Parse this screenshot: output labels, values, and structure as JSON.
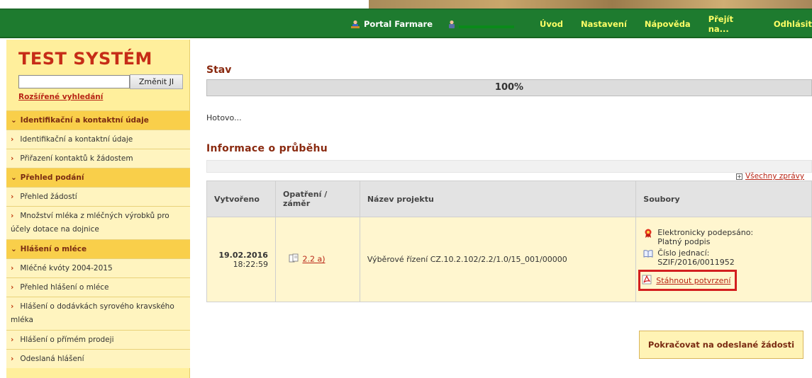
{
  "header": {
    "portal_label": "Portal Farmare",
    "nav": [
      "Úvod",
      "Nastavení",
      "Nápověda",
      "Přejít na...",
      "Odhlásit"
    ],
    "accent": "#1e7b2f"
  },
  "sidebar": {
    "logo": "TEST SYSTÉM",
    "search_value": "",
    "search_button": "Změnit JI",
    "advanced_search": "Rozšířené vyhledání",
    "menu": [
      {
        "type": "section",
        "label": "Identifikační a kontaktní údaje"
      },
      {
        "type": "item",
        "label": "Identifikační a kontaktní údaje"
      },
      {
        "type": "item",
        "label": "Přiřazení kontaktů k žádostem"
      },
      {
        "type": "section",
        "label": "Přehled podání"
      },
      {
        "type": "item",
        "label": "Přehled žádostí"
      },
      {
        "type": "item",
        "label": "Množství mléka z mléčných výrobků pro účely dotace na dojnice"
      },
      {
        "type": "section",
        "label": "Hlášení o mléce"
      },
      {
        "type": "item",
        "label": "Mléčné kvóty 2004-2015"
      },
      {
        "type": "item",
        "label": "Přehled hlášení o mléce"
      },
      {
        "type": "item",
        "label": "Hlášení o dodávkách syrového kravského mléka"
      },
      {
        "type": "item",
        "label": "Hlášení o přímém prodeji"
      },
      {
        "type": "item",
        "label": "Odeslaná hlášení"
      }
    ]
  },
  "main": {
    "stav_title": "Stav",
    "progress_text": "100%",
    "progress_value": 100,
    "status_text": "Hotovo...",
    "info_title": "Informace o průběhu",
    "all_messages": "Všechny zprávy",
    "table": {
      "headers": [
        "Vytvořeno",
        "Opatření / záměr",
        "Název projektu",
        "Soubory"
      ],
      "row": {
        "date": "19.02.2016",
        "time": "18:22:59",
        "measure": "2.2 a)",
        "project": "Výběrové řízení CZ.10.2.102/2.2/1.0/15_001/00000",
        "signed_label": "Elektronicky podepsáno:",
        "signed_value": "Platný podpis",
        "ref_label": "Číslo jednací:",
        "ref_value": "SZIF/2016/0011952",
        "download": "Stáhnout potvrzení"
      }
    },
    "continue_button": "Pokračovat na odeslané žádosti"
  }
}
